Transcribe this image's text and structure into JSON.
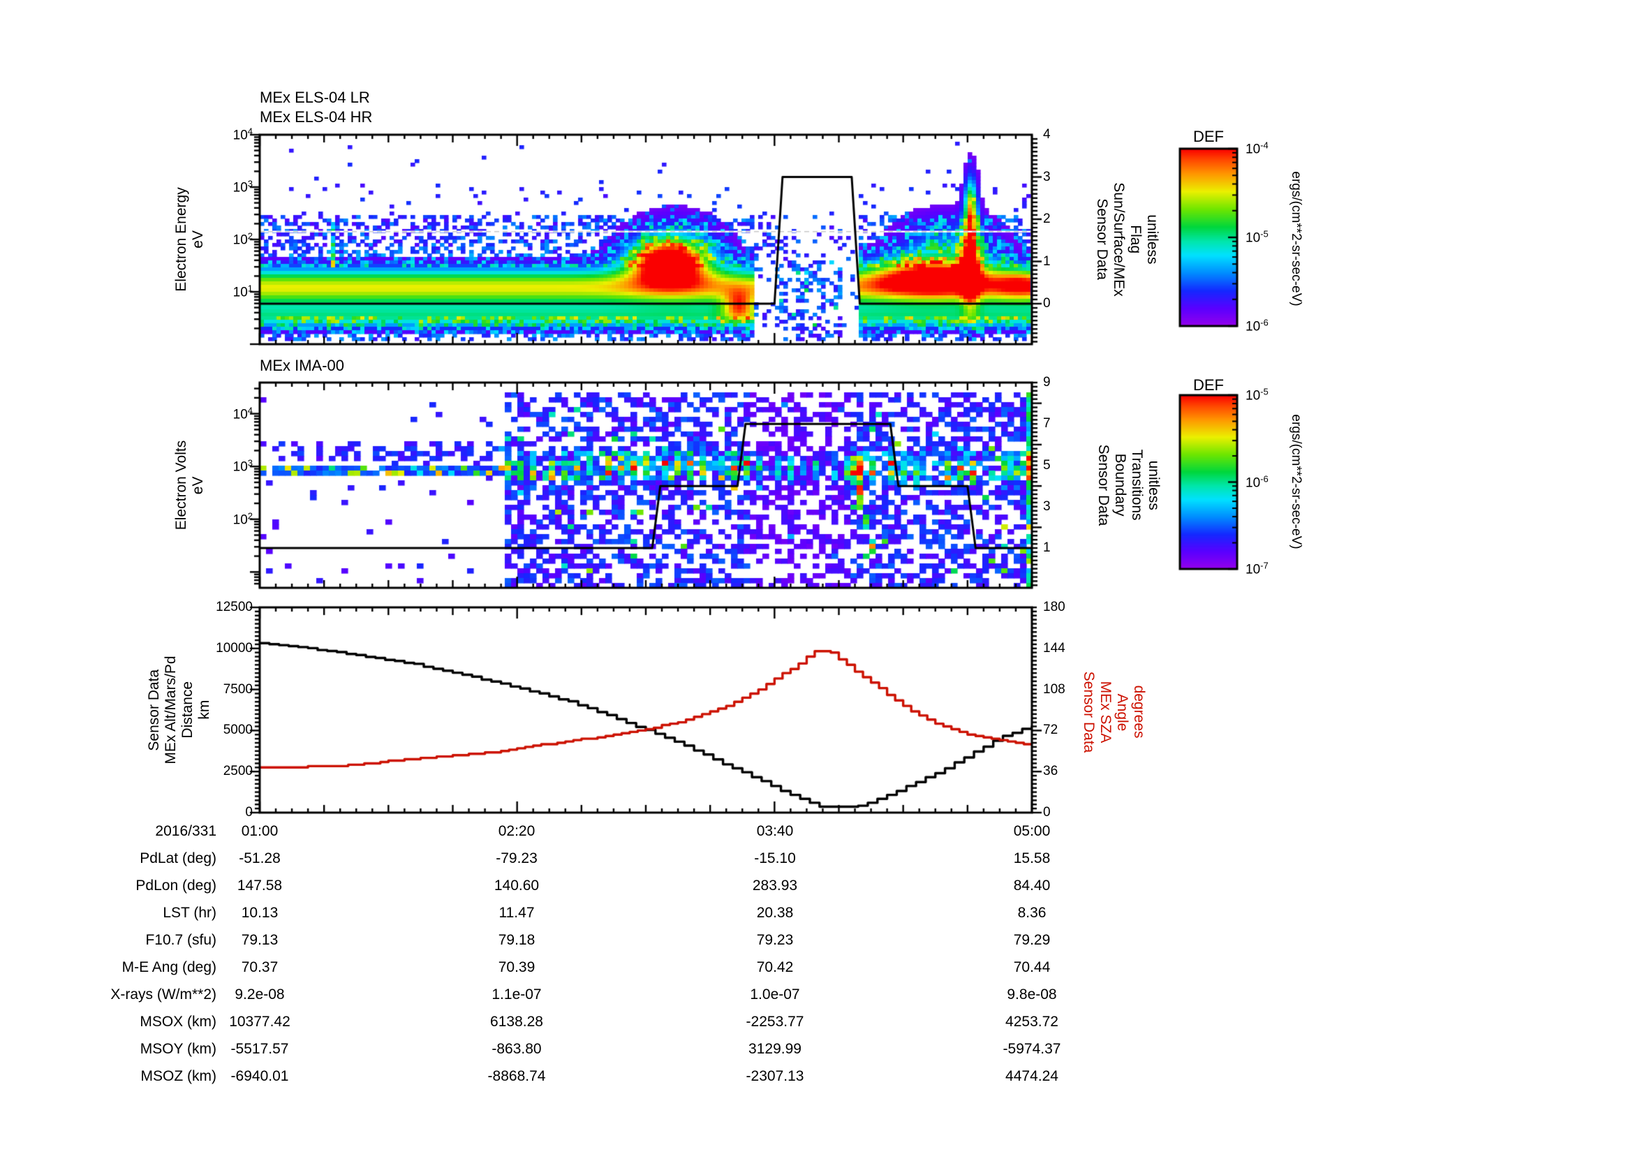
{
  "figure": {
    "date_label": "2016/331",
    "time_tick_labels": [
      "01:00",
      "02:20",
      "03:40",
      "05:00"
    ],
    "colors": {
      "background": "#ffffff",
      "axis": "#000000",
      "curve_distance": "#000000",
      "curve_sza": "#cc1100",
      "spectrogram_palette_low": "#9600eb",
      "spectrogram_palette_high": "#fa0000"
    },
    "panels": {
      "els": {
        "titles": [
          "MEx ELS-04 LR",
          "MEx ELS-04 HR"
        ],
        "ylabel_lines": [
          "Electron Energy",
          "eV"
        ],
        "ytick_labels": [
          "10^4",
          "10^3",
          "10^2",
          "10^1"
        ],
        "right_label_lines": [
          "Sensor Data",
          "Sun/Surface/MEx",
          "Flag",
          "unitless"
        ],
        "right_tick_labels": [
          "4",
          "3",
          "2",
          "1",
          "0"
        ]
      },
      "ima": {
        "title": "MEx IMA-00",
        "ylabel_lines": [
          "Electron Volts",
          "eV"
        ],
        "ytick_labels": [
          "10^4",
          "10^3",
          "10^2"
        ],
        "right_label_lines": [
          "Sensor Data",
          "Boundary",
          "Transitions",
          "unitless"
        ],
        "right_tick_labels": [
          "9",
          "7",
          "5",
          "3",
          "1"
        ]
      },
      "ts": {
        "ylabel_lines": [
          "Sensor Data",
          "MEx Alt/Mars/Pd",
          "Distance",
          "km"
        ],
        "ytick_labels": [
          "12500",
          "10000",
          "7500",
          "5000",
          "2500",
          "0"
        ],
        "right_label_lines": [
          "Sensor Data",
          "MEx SZA",
          "Angle",
          "degrees"
        ],
        "right_tick_labels": [
          "180",
          "144",
          "108",
          "72",
          "36",
          "0"
        ]
      }
    },
    "colorbars": [
      {
        "title": "DEF",
        "unit": "ergs/(cm**2-sr-sec-eV)",
        "tick_labels": [
          "10^-4",
          "10^-5",
          "10^-6"
        ]
      },
      {
        "title": "DEF",
        "unit": "ergs/(cm**2-sr-sec-eV)",
        "tick_labels": [
          "10^-5",
          "10^-6",
          "10^-7"
        ]
      }
    ]
  },
  "table": {
    "rows": [
      {
        "label": "2016/331",
        "values": [
          "01:00",
          "02:20",
          "03:40",
          "05:00"
        ]
      },
      {
        "label": "PdLat (deg)",
        "values": [
          "-51.28",
          "-79.23",
          "-15.10",
          "15.58"
        ]
      },
      {
        "label": "PdLon (deg)",
        "values": [
          "147.58",
          "140.60",
          "283.93",
          "84.40"
        ]
      },
      {
        "label": "LST (hr)",
        "values": [
          "10.13",
          "11.47",
          "20.38",
          "8.36"
        ]
      },
      {
        "label": "F10.7 (sfu)",
        "values": [
          "79.13",
          "79.18",
          "79.23",
          "79.29"
        ]
      },
      {
        "label": "M-E Ang (deg)",
        "values": [
          "70.37",
          "70.39",
          "70.42",
          "70.44"
        ]
      },
      {
        "label": "X-rays (W/m**2)",
        "values": [
          "9.2e-08",
          "1.1e-07",
          "1.0e-07",
          "9.8e-08"
        ]
      },
      {
        "label": "MSOX (km)",
        "values": [
          "10377.42",
          "6138.28",
          "-2253.77",
          "4253.72"
        ]
      },
      {
        "label": "MSOY (km)",
        "values": [
          "-5517.57",
          "-863.80",
          "3129.99",
          "-5974.37"
        ]
      },
      {
        "label": "MSOZ (km)",
        "values": [
          "-6940.01",
          "-8868.74",
          "-2307.13",
          "4474.24"
        ]
      }
    ]
  },
  "chart_data": [
    {
      "type": "heatmap",
      "id": "els",
      "title": "MEx ELS-04 LR / MEx ELS-04 HR",
      "xlabel": "time, 2016/331 01:00 to 05:00 (minutes from 01:00)",
      "ylabel": "Electron Energy eV (log10 scale)",
      "x_range_minutes": [
        0,
        240
      ],
      "y_log10_ev_range": [
        0,
        4
      ],
      "colorbar": {
        "title": "DEF",
        "unit": "ergs/(cm**2-sr-sec-eV)",
        "min": "1e-6",
        "max": "1e-4"
      },
      "seed": 11,
      "cell": [
        6,
        5
      ],
      "dashed_line_log10_ev": 2.15,
      "features": [
        {
          "name": "core-band",
          "type": "band",
          "t": [
            0,
            240
          ],
          "e": 1.08,
          "sig": 0.27,
          "amp": 0.76
        },
        {
          "name": "cyan-sub-band",
          "type": "band",
          "t": [
            0,
            240
          ],
          "e": 0.5,
          "sig": 0.16,
          "amp": 0.42
        },
        {
          "name": "upper-speckle",
          "type": "speckle",
          "t": [
            0,
            240
          ],
          "e0": 1.5,
          "e1": 2.45,
          "prob": 0.42,
          "a0": 0.1,
          "a1": 0.3
        },
        {
          "name": "mid-speckle",
          "type": "speckle",
          "t": [
            0,
            240
          ],
          "e0": 2.45,
          "e1": 3.05,
          "prob": 0.05,
          "a0": 0.12,
          "a1": 0.22
        },
        {
          "name": "rare-high-dots",
          "type": "speckle",
          "t": [
            0,
            240
          ],
          "e0": 3.05,
          "e1": 3.85,
          "prob": 0.008,
          "a0": 0.15,
          "a1": 0.2
        },
        {
          "name": "lower-speckle",
          "type": "speckle",
          "t": [
            0,
            240
          ],
          "e0": 0.05,
          "e1": 0.5,
          "prob": 0.45,
          "a0": 0.1,
          "a1": 0.3
        },
        {
          "name": "cyan-streak-0124",
          "type": "column",
          "t": [
            21.5,
            23.5
          ],
          "e0": 1.45,
          "e1": 2.3,
          "amp": 0.45,
          "prob": 0.8
        },
        {
          "name": "sheath-red-blob",
          "type": "blob",
          "tc": 127,
          "tsig": 8,
          "e": 1.6,
          "esig": 0.27,
          "amp": 0.95
        },
        {
          "name": "sheath-red-halo",
          "type": "blob",
          "tc": 129,
          "tsig": 11,
          "e": 1.75,
          "esig": 0.5,
          "amp": 0.3
        },
        {
          "name": "pre-gap-low-yellow",
          "type": "blob",
          "tc": 149,
          "tsig": 3.5,
          "e": 0.72,
          "esig": 0.2,
          "amp": 0.5
        },
        {
          "name": "eclipse-gap",
          "type": "suppress",
          "t": [
            153,
            186
          ],
          "factor": 0.05
        },
        {
          "name": "gap-dots",
          "type": "speckle",
          "post": true,
          "t": [
            153,
            186
          ],
          "e0": 0.3,
          "e1": 2.5,
          "prob": 0.13,
          "a0": 0.1,
          "a1": 0.28
        },
        {
          "name": "gap-dots-low",
          "type": "speckle",
          "post": true,
          "t": [
            162,
            181
          ],
          "e0": 0.1,
          "e1": 1.6,
          "prob": 0.3,
          "a0": 0.1,
          "a1": 0.3
        },
        {
          "name": "post-gap-red-band",
          "type": "blob",
          "tc": 208,
          "tsig": 13,
          "e": 1.33,
          "esig": 0.27,
          "amp": 0.62
        },
        {
          "name": "post-gap-upper-rise",
          "type": "blob",
          "tc": 214,
          "tsig": 12,
          "e": 1.9,
          "esig": 0.45,
          "amp": 0.26
        },
        {
          "name": "spike-column",
          "type": "blob",
          "tc": 221,
          "tsig": 1.7,
          "e": 1.9,
          "esig": 0.8,
          "amp": 0.6
        },
        {
          "name": "spike-tip",
          "type": "blob",
          "tc": 221,
          "tsig": 1.2,
          "e": 2.6,
          "esig": 0.35,
          "amp": 0.4
        },
        {
          "name": "spike-red-base",
          "type": "blob",
          "tc": 220.5,
          "tsig": 2.2,
          "e": 1.5,
          "esig": 0.35,
          "amp": 0.5
        },
        {
          "name": "right-edge-orange",
          "type": "blob",
          "tc": 237,
          "tsig": 6,
          "e": 1.15,
          "esig": 0.2,
          "amp": 0.3
        }
      ],
      "overlay_line": {
        "name": "Sun/Surface/MEx Flag",
        "axis_values": [
          0,
          4
        ],
        "points_t_value": [
          [
            0,
            0
          ],
          [
            160,
            0
          ],
          [
            162.5,
            3
          ],
          [
            184,
            3
          ],
          [
            186.5,
            0
          ],
          [
            240,
            0
          ]
        ]
      }
    },
    {
      "type": "heatmap",
      "id": "ima",
      "title": "MEx IMA-00",
      "xlabel": "time, 2016/331 01:00 to 05:00 (minutes from 01:00)",
      "ylabel": "Electron Volts eV (log10 scale)",
      "x_range_minutes": [
        0,
        240
      ],
      "y_log10_ev_range": [
        0.7,
        4.59
      ],
      "colorbar": {
        "title": "DEF",
        "unit": "ergs/(cm**2-sr-sec-eV)",
        "min": "1e-7",
        "max": "1e-5"
      },
      "seed": 7,
      "cell": [
        9,
        7
      ],
      "features": [
        {
          "name": "solar-wind-stripe",
          "type": "speckle",
          "t": [
            0,
            76
          ],
          "e0": 2.8,
          "e1": 3.04,
          "prob": 0.93,
          "a0": 0.18,
          "a1": 0.3
        },
        {
          "name": "stripe-cyan-segments",
          "type": "speckle",
          "t": [
            0,
            76
          ],
          "e0": 2.82,
          "e1": 3.02,
          "prob": 0.22,
          "a0": 0.4,
          "a1": 0.58
        },
        {
          "name": "stripe-upper-speckle",
          "type": "speckle",
          "t": [
            0,
            76
          ],
          "e0": 3.08,
          "e1": 3.5,
          "prob": 0.35,
          "a0": 0.1,
          "a1": 0.24
        },
        {
          "name": "sparse-dots",
          "type": "speckle",
          "t": [
            0,
            76
          ],
          "e0": 0.8,
          "e1": 4.3,
          "prob": 0.03,
          "a0": 0.1,
          "a1": 0.2
        },
        {
          "name": "dense-field",
          "type": "speckle",
          "t": [
            76,
            240
          ],
          "e0": 0.72,
          "e1": 4.45,
          "prob": 0.5,
          "a0": 0.09,
          "a1": 0.26
        },
        {
          "name": "dense-mid-band",
          "type": "speckle",
          "t": [
            76,
            240
          ],
          "e0": 2.7,
          "e1": 3.25,
          "prob": 0.45,
          "a0": 0.14,
          "a1": 0.38
        },
        {
          "name": "periodic-beam-blobs",
          "type": "periodic",
          "t": [
            76,
            240
          ],
          "period": 4.4,
          "e": 2.95,
          "sig": 0.17,
          "amp": 0.5
        },
        {
          "name": "bright-dots",
          "type": "speckle",
          "t": [
            76,
            240
          ],
          "e0": 1.0,
          "e1": 4.2,
          "prob": 0.015,
          "a0": 0.38,
          "a1": 0.55
        },
        {
          "name": "eclipse-lighten",
          "type": "suppress",
          "t": [
            152,
            184
          ],
          "factor": 0.55
        },
        {
          "name": "green-spot",
          "type": "blob",
          "post": true,
          "tc": 185,
          "tsig": 1.5,
          "e": 2.9,
          "esig": 0.2,
          "amp": 0.6
        },
        {
          "name": "diagonal-streak",
          "type": "diag",
          "post": true,
          "t": [
            186,
            192
          ],
          "e0": 2.55,
          "e1": 1.1,
          "w": 0.18,
          "amp": 0.55
        },
        {
          "name": "right-edge-cyan-column",
          "type": "column",
          "post": true,
          "t": [
            237.6,
            240
          ],
          "e0": 0.72,
          "e1": 4.45,
          "amp": 0.42,
          "prob": 0.9
        }
      ],
      "overlay_line": {
        "name": "Boundary Transitions",
        "axis_values": [
          1,
          9
        ],
        "points_t_value": [
          [
            0,
            1
          ],
          [
            122,
            1
          ],
          [
            124.5,
            4
          ],
          [
            148.5,
            4
          ],
          [
            151,
            7
          ],
          [
            196,
            7
          ],
          [
            198.5,
            4
          ],
          [
            220,
            4
          ],
          [
            222.5,
            1
          ],
          [
            240,
            1
          ]
        ]
      }
    },
    {
      "type": "line",
      "id": "ts",
      "title": "MEx distance and solar zenith angle",
      "x_range_minutes": [
        0,
        240
      ],
      "series": [
        {
          "name": "MEx Alt/Mars/Pd Distance",
          "unit": "km",
          "color": "#000000",
          "axis_range": [
            0,
            12500
          ],
          "quantize": 60,
          "hold_minutes": 3,
          "points_t_value": [
            [
              0,
              10330
            ],
            [
              12,
              10075
            ],
            [
              24,
              9750
            ],
            [
              36,
              9400
            ],
            [
              48,
              9030
            ],
            [
              60,
              8520
            ],
            [
              72,
              7990
            ],
            [
              84,
              7400
            ],
            [
              96,
              6760
            ],
            [
              108,
              5920
            ],
            [
              120,
              5020
            ],
            [
              132,
              4060
            ],
            [
              144,
              2960
            ],
            [
              156,
              1930
            ],
            [
              163,
              1220
            ],
            [
              168,
              840
            ],
            [
              173,
              390
            ],
            [
              176,
              330
            ],
            [
              184,
              330
            ],
            [
              188,
              490
            ],
            [
              192,
              840
            ],
            [
              197,
              1220
            ],
            [
              204,
              1870
            ],
            [
              211,
              2510
            ],
            [
              216,
              3030
            ],
            [
              223,
              3810
            ],
            [
              230,
              4580
            ],
            [
              240,
              5300
            ]
          ]
        },
        {
          "name": "MEx SZA Angle",
          "unit": "degrees",
          "color": "#cc1100",
          "axis_range": [
            0,
            180
          ],
          "quantize": 1.2,
          "hold_minutes": 2.5,
          "points_t_value": [
            [
              0,
              40
            ],
            [
              12,
              40
            ],
            [
              24,
              41
            ],
            [
              36,
              44
            ],
            [
              48,
              47
            ],
            [
              60,
              50
            ],
            [
              72,
              53
            ],
            [
              84,
              58
            ],
            [
              96,
              63
            ],
            [
              108,
              67
            ],
            [
              120,
              73
            ],
            [
              132,
              81
            ],
            [
              144,
              92
            ],
            [
              154,
              106
            ],
            [
              162,
              121
            ],
            [
              166,
              128
            ],
            [
              170,
              137
            ],
            [
              172,
              141
            ],
            [
              177,
              141
            ],
            [
              180,
              134
            ],
            [
              184,
              126
            ],
            [
              188,
              118
            ],
            [
              192,
              110
            ],
            [
              197,
              99
            ],
            [
              204,
              86
            ],
            [
              211,
              77
            ],
            [
              218,
              70
            ],
            [
              226,
              65
            ],
            [
              233,
              62
            ],
            [
              240,
              59
            ]
          ]
        }
      ]
    }
  ]
}
